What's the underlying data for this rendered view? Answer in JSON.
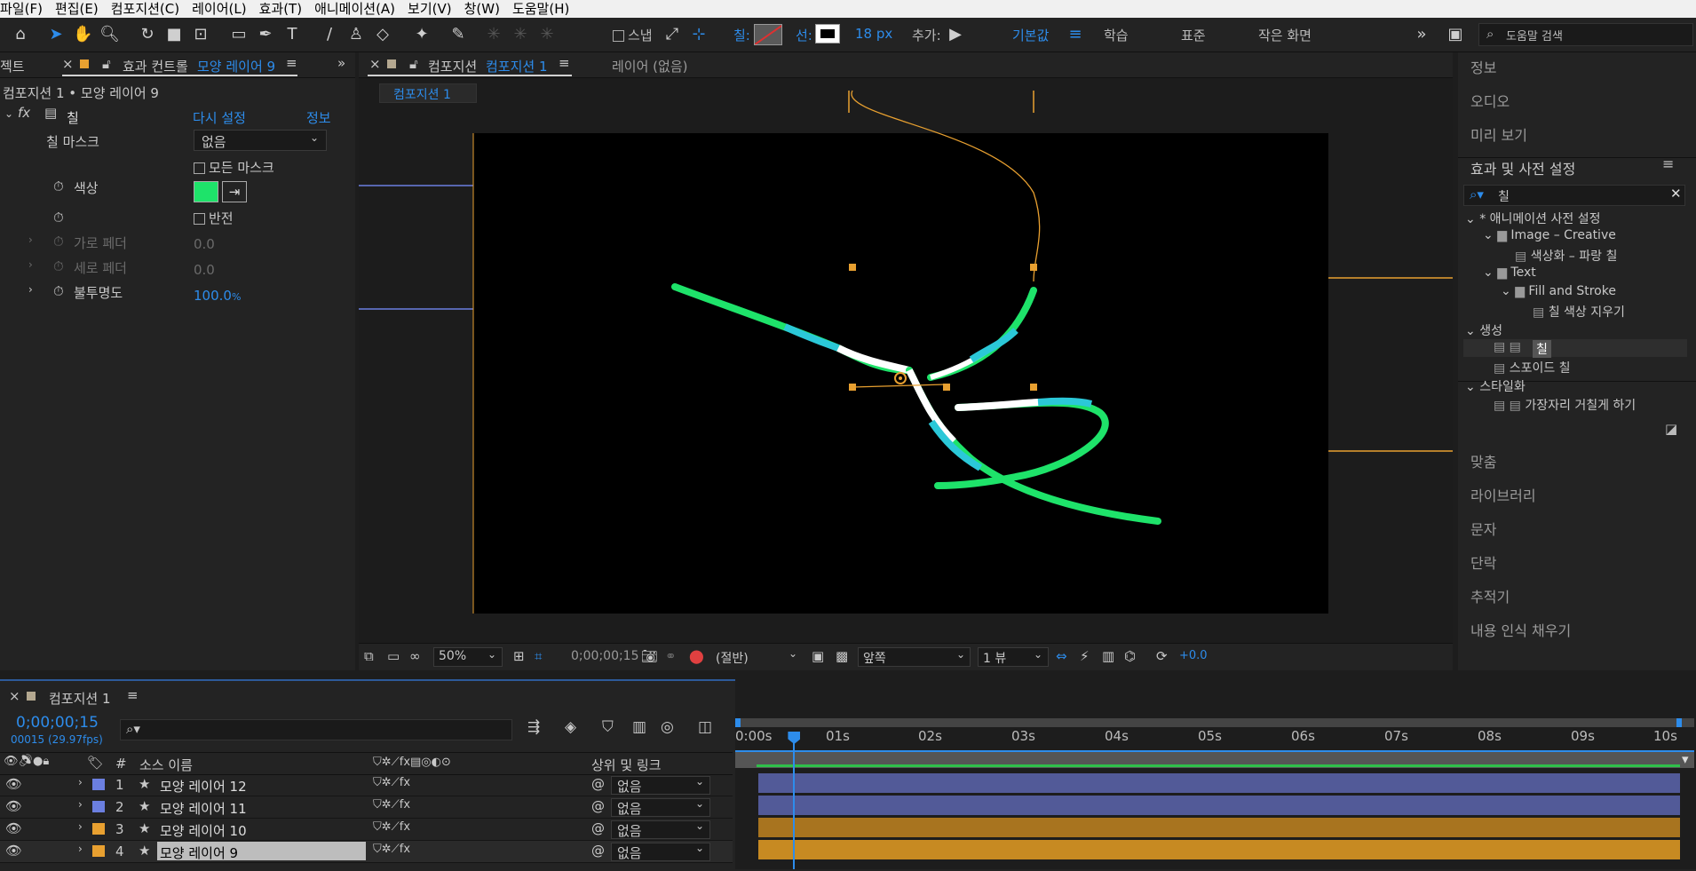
{
  "menu": [
    "파일(F)",
    "편집(E)",
    "컴포지션(C)",
    "레이어(L)",
    "효과(T)",
    "애니메이션(A)",
    "보기(V)",
    "창(W)",
    "도움말(H)"
  ],
  "toolbar": {
    "snap_label": "스냅",
    "fill_label": "칠:",
    "stroke_label": "선:",
    "stroke_width": "18 px",
    "add_label": "추가:",
    "workspaces": [
      "기본값",
      "학습",
      "표준",
      "작은 화면"
    ],
    "search_placeholder": "도움말 검색"
  },
  "effects_panel": {
    "left_tab_fragment": "젝트",
    "tab_prefix": "효과 컨트롤",
    "tab_layer": "모양 레이어 9",
    "breadcrumb": "컴포지션 1 • 모양 레이어 9",
    "effect_name": "칠",
    "reset_label": "다시 설정",
    "info_label": "정보",
    "fill_mask_label": "칠 마스크",
    "fill_mask_value": "없음",
    "all_masks_label": "모든 마스크",
    "color_label": "색상",
    "color_value": "#1ee36a",
    "invert_label": "반전",
    "h_feather_label": "가로 페더",
    "h_feather_value": "0.0",
    "v_feather_label": "세로 페더",
    "v_feather_value": "0.0",
    "opacity_label": "불투명도",
    "opacity_value": "100.0",
    "opacity_unit": "%"
  },
  "comp_panel": {
    "tab_prefix": "컴포지션",
    "tab_name": "컴포지션 1",
    "layer_tab": "레이어 (없음)",
    "breadcrumb": "컴포지션 1",
    "zoom": "50%",
    "timecode": "0;00;00;15",
    "resolution": "(절반)",
    "view": "앞쪽",
    "views_count": "1 뷰",
    "exposure": "+0.0"
  },
  "right_panel": {
    "top_items": [
      "정보",
      "오디오",
      "미리 보기"
    ],
    "effects_title": "효과 및 사전 설정",
    "search_value": "칠",
    "tree": [
      {
        "label": "* 애니메이션 사전 설정",
        "level": 0,
        "type": "group"
      },
      {
        "label": "Image – Creative",
        "level": 1,
        "type": "folder"
      },
      {
        "label": "색상화 – 파랑 칠",
        "level": 2,
        "type": "preset"
      },
      {
        "label": "Text",
        "level": 1,
        "type": "folder"
      },
      {
        "label": "Fill and Stroke",
        "level": 2,
        "type": "folder"
      },
      {
        "label": "칠 색상 지우기",
        "level": 3,
        "type": "preset"
      },
      {
        "label": "생성",
        "level": 0,
        "type": "group"
      },
      {
        "label": "칠",
        "level": 1,
        "type": "effect"
      },
      {
        "label": "스포이드 칠",
        "level": 1,
        "type": "effect"
      },
      {
        "label": "스타일화",
        "level": 0,
        "type": "group"
      },
      {
        "label": "가장자리 거칠게 하기",
        "level": 1,
        "type": "effect"
      }
    ],
    "bottom_items": [
      "맞춤",
      "라이브러리",
      "문자",
      "단락",
      "추적기",
      "내용 인식 채우기"
    ]
  },
  "timeline": {
    "comp_tab": "컴포지션 1",
    "timecode": "0;00;00;15",
    "frame_info": "00015 (29.97fps)",
    "col_hash": "#",
    "col_source": "소스 이름",
    "col_parent": "상위 및 링크",
    "ruler": [
      "0:00s",
      "01s",
      "02s",
      "03s",
      "04s",
      "05s",
      "06s",
      "07s",
      "08s",
      "09s",
      "10s"
    ],
    "playhead_seconds": 0.5,
    "layers": [
      {
        "num": "1",
        "name": "모양 레이어 12",
        "color": "#6b7fe0",
        "parent": "없음"
      },
      {
        "num": "2",
        "name": "모양 레이어 11",
        "color": "#6b7fe0",
        "parent": "없음"
      },
      {
        "num": "3",
        "name": "모양 레이어 10",
        "color": "#e8a030",
        "parent": "없음"
      },
      {
        "num": "4",
        "name": "모양 레이어 9",
        "color": "#e8a030",
        "parent": "없음"
      }
    ]
  }
}
